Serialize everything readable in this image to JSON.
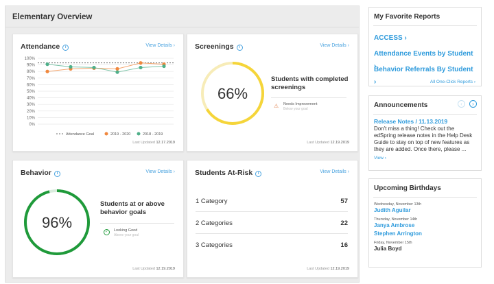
{
  "main": {
    "title": "Elementary Overview"
  },
  "common": {
    "view_details": "View Details",
    "last_updated_label": "Last Updated"
  },
  "attendance": {
    "title": "Attendance",
    "last_updated": "12.17.2019",
    "legend": {
      "goal": "Attendance Goal",
      "s1": "2019 - 2020",
      "s2": "2018 - 2019"
    },
    "colors": {
      "s1": "#f0883e",
      "s2": "#4faf89",
      "goal": "#555555"
    }
  },
  "chart_data": {
    "type": "line",
    "y_ticks": [
      "100%",
      "90%",
      "80%",
      "70%",
      "60%",
      "50%",
      "40%",
      "30%",
      "20%",
      "10%",
      "0%"
    ],
    "ylim": [
      0,
      100
    ],
    "grid": true,
    "legend_position": "bottom",
    "goal": 93,
    "series": [
      {
        "name": "2019 - 2020",
        "values": [
          80,
          84,
          85,
          84,
          93,
          91
        ]
      },
      {
        "name": "2018 - 2019",
        "values": [
          91,
          87,
          86,
          79,
          86,
          88
        ]
      }
    ]
  },
  "screenings": {
    "title": "Screenings",
    "percent": "66%",
    "progress": 0.66,
    "heading": "Students with completed screenings",
    "status": "Needs Improvement",
    "status_sub": "Below your goal",
    "last_updated": "12.19.2019",
    "color": "#f5d53a"
  },
  "behavior": {
    "title": "Behavior",
    "percent": "96%",
    "progress": 0.96,
    "heading": "Students at or above behavior goals",
    "status": "Looking Good",
    "status_sub": "Above your goal",
    "last_updated": "12.19.2019",
    "color": "#1f9a3a"
  },
  "at_risk": {
    "title": "Students At-Risk",
    "last_updated": "12.19.2019",
    "rows": [
      {
        "label": "1 Category",
        "count": "57"
      },
      {
        "label": "2 Categories",
        "count": "22"
      },
      {
        "label": "3 Categories",
        "count": "16"
      }
    ]
  },
  "favorites": {
    "title": "My Favorite Reports",
    "links": [
      "ACCESS",
      "Attendance Events by Student",
      "Behavior Referrals By Student"
    ],
    "all_link": "All One-Click Reports"
  },
  "announcements": {
    "title": "Announcements",
    "item_title": "Release Notes / 11.13.2019",
    "body": "Don't miss a thing! Check out the edSpring release notes in the Help Desk Guide to stay on top of new features as they are added. Once there, please ...",
    "view_link": "View"
  },
  "birthdays": {
    "title": "Upcoming Birthdays",
    "groups": [
      {
        "date": "Wednesday, November 13th",
        "names": [
          "Judith Aguilar"
        ]
      },
      {
        "date": "Thursday, November 14th",
        "names": [
          "Janya Ambrose",
          "Stephen Arrington"
        ]
      },
      {
        "date": "Friday, November 15th",
        "names": [
          "Julia Boyd"
        ]
      }
    ]
  }
}
